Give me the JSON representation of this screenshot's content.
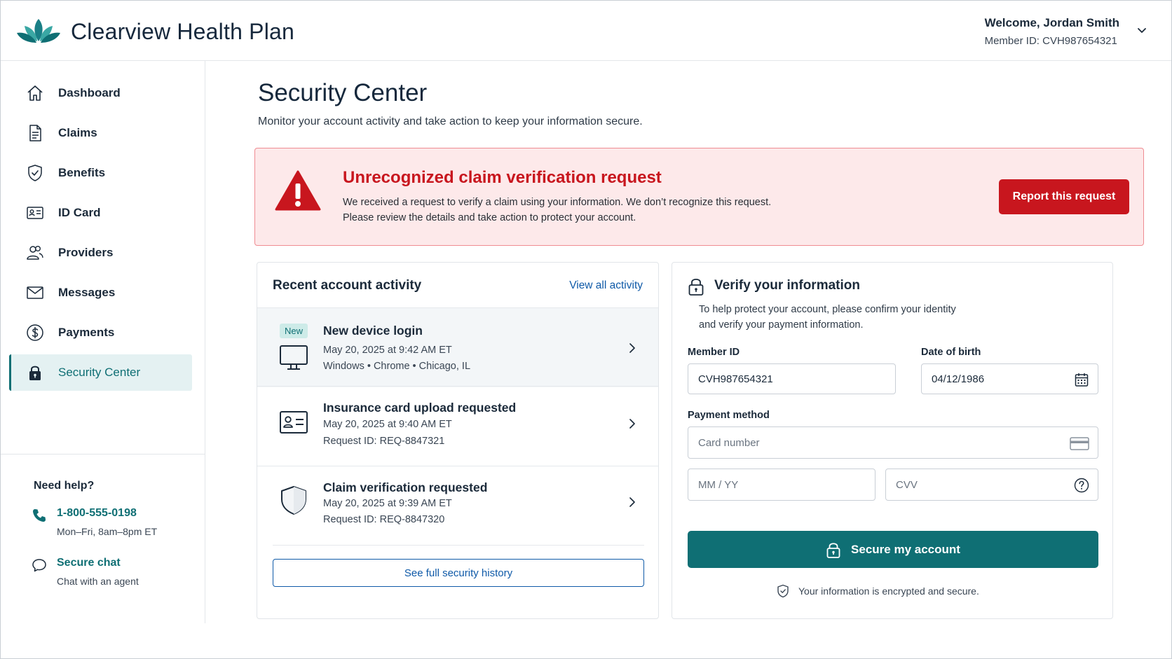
{
  "header": {
    "brand": "Clearview Health Plan",
    "welcome": "Welcome, Jordan Smith",
    "member_id": "Member ID: CVH987654321"
  },
  "sidebar": {
    "items": [
      {
        "label": "Dashboard",
        "icon": "home-icon"
      },
      {
        "label": "Claims",
        "icon": "document-icon"
      },
      {
        "label": "Benefits",
        "icon": "shield-check-icon"
      },
      {
        "label": "ID Card",
        "icon": "id-card-icon"
      },
      {
        "label": "Providers",
        "icon": "people-icon"
      },
      {
        "label": "Messages",
        "icon": "envelope-icon"
      },
      {
        "label": "Payments",
        "icon": "dollar-icon"
      },
      {
        "label": "Security Center",
        "icon": "lock-icon",
        "active": true
      }
    ],
    "help": {
      "title": "Need help?",
      "phone": "1-800-555-0198",
      "hours": "Mon–Fri, 8am–8pm ET",
      "chat": "Secure chat",
      "chat_sub": "Chat with an agent"
    }
  },
  "main": {
    "title": "Security Center",
    "subtitle": "Monitor your account activity and take action to keep your information secure."
  },
  "alert": {
    "title": "Unrecognized claim verification request",
    "line1": "We received a request to verify a claim using your information.  We don’t recognize this request.",
    "line2": "Please review the details and take action to protect your account.",
    "button": "Report this request"
  },
  "activity": {
    "title": "Recent account activity",
    "view_all": "View all activity",
    "items": [
      {
        "badge": "New",
        "title": "New device login",
        "line2": "May 20, 2025 at 9:42 AM ET",
        "line3": "Windows • Chrome • Chicago, IL",
        "icon": "monitor-icon"
      },
      {
        "title": "Insurance card upload requested",
        "line2": "May 20, 2025 at 9:40 AM ET",
        "line3": "Request ID: REQ-8847321",
        "icon": "id-card-icon"
      },
      {
        "title": "Claim verification requested",
        "line2": "May 20, 2025 at 9:39 AM ET",
        "line3": "Request ID: REQ-8847320",
        "icon": "shield-icon"
      }
    ],
    "history_button": "See full security history"
  },
  "verify": {
    "title": "Verify your information",
    "desc1": "To help protect your account, please confirm your identity",
    "desc2": "and verify your payment information.",
    "member_id_label": "Member ID",
    "member_id_value": "CVH987654321",
    "dob_label": "Date of birth",
    "dob_value": "04/12/1986",
    "payment_label": "Payment method",
    "card_placeholder": "Card number",
    "exp_placeholder": "MM / YY",
    "cvv_placeholder": "CVV",
    "button": "Secure my account",
    "note": "Your information is encrypted and secure."
  },
  "colors": {
    "brand_teal": "#0f6f74",
    "alert_red": "#c8161e",
    "alert_bg": "#fde9ea",
    "link_blue": "#0f5aa8"
  }
}
